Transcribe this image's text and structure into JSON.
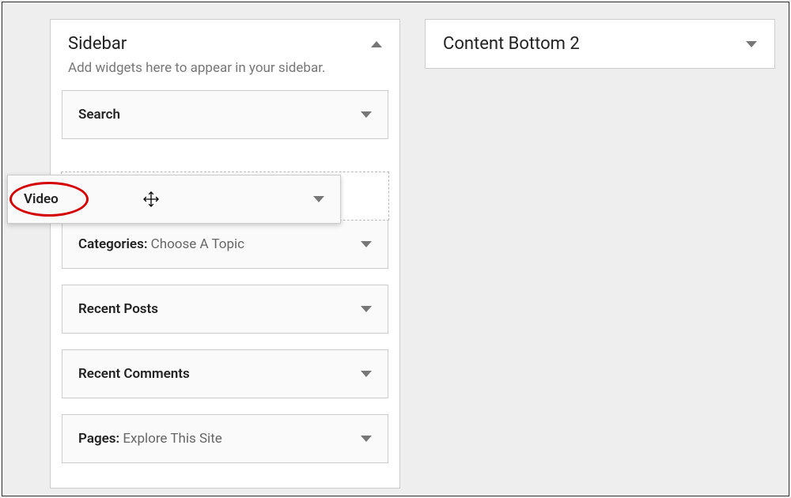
{
  "sidebar": {
    "title": "Sidebar",
    "description": "Add widgets here to appear in your sidebar.",
    "widgets": [
      {
        "label": "Search",
        "suffix": ""
      },
      {
        "label": "Categories:",
        "suffix": " Choose A Topic"
      },
      {
        "label": "Recent Posts",
        "suffix": ""
      },
      {
        "label": "Recent Comments",
        "suffix": ""
      },
      {
        "label": "Pages:",
        "suffix": " Explore This Site"
      }
    ]
  },
  "content_bottom": {
    "title": "Content Bottom 2"
  },
  "dragged": {
    "label": "Video"
  }
}
